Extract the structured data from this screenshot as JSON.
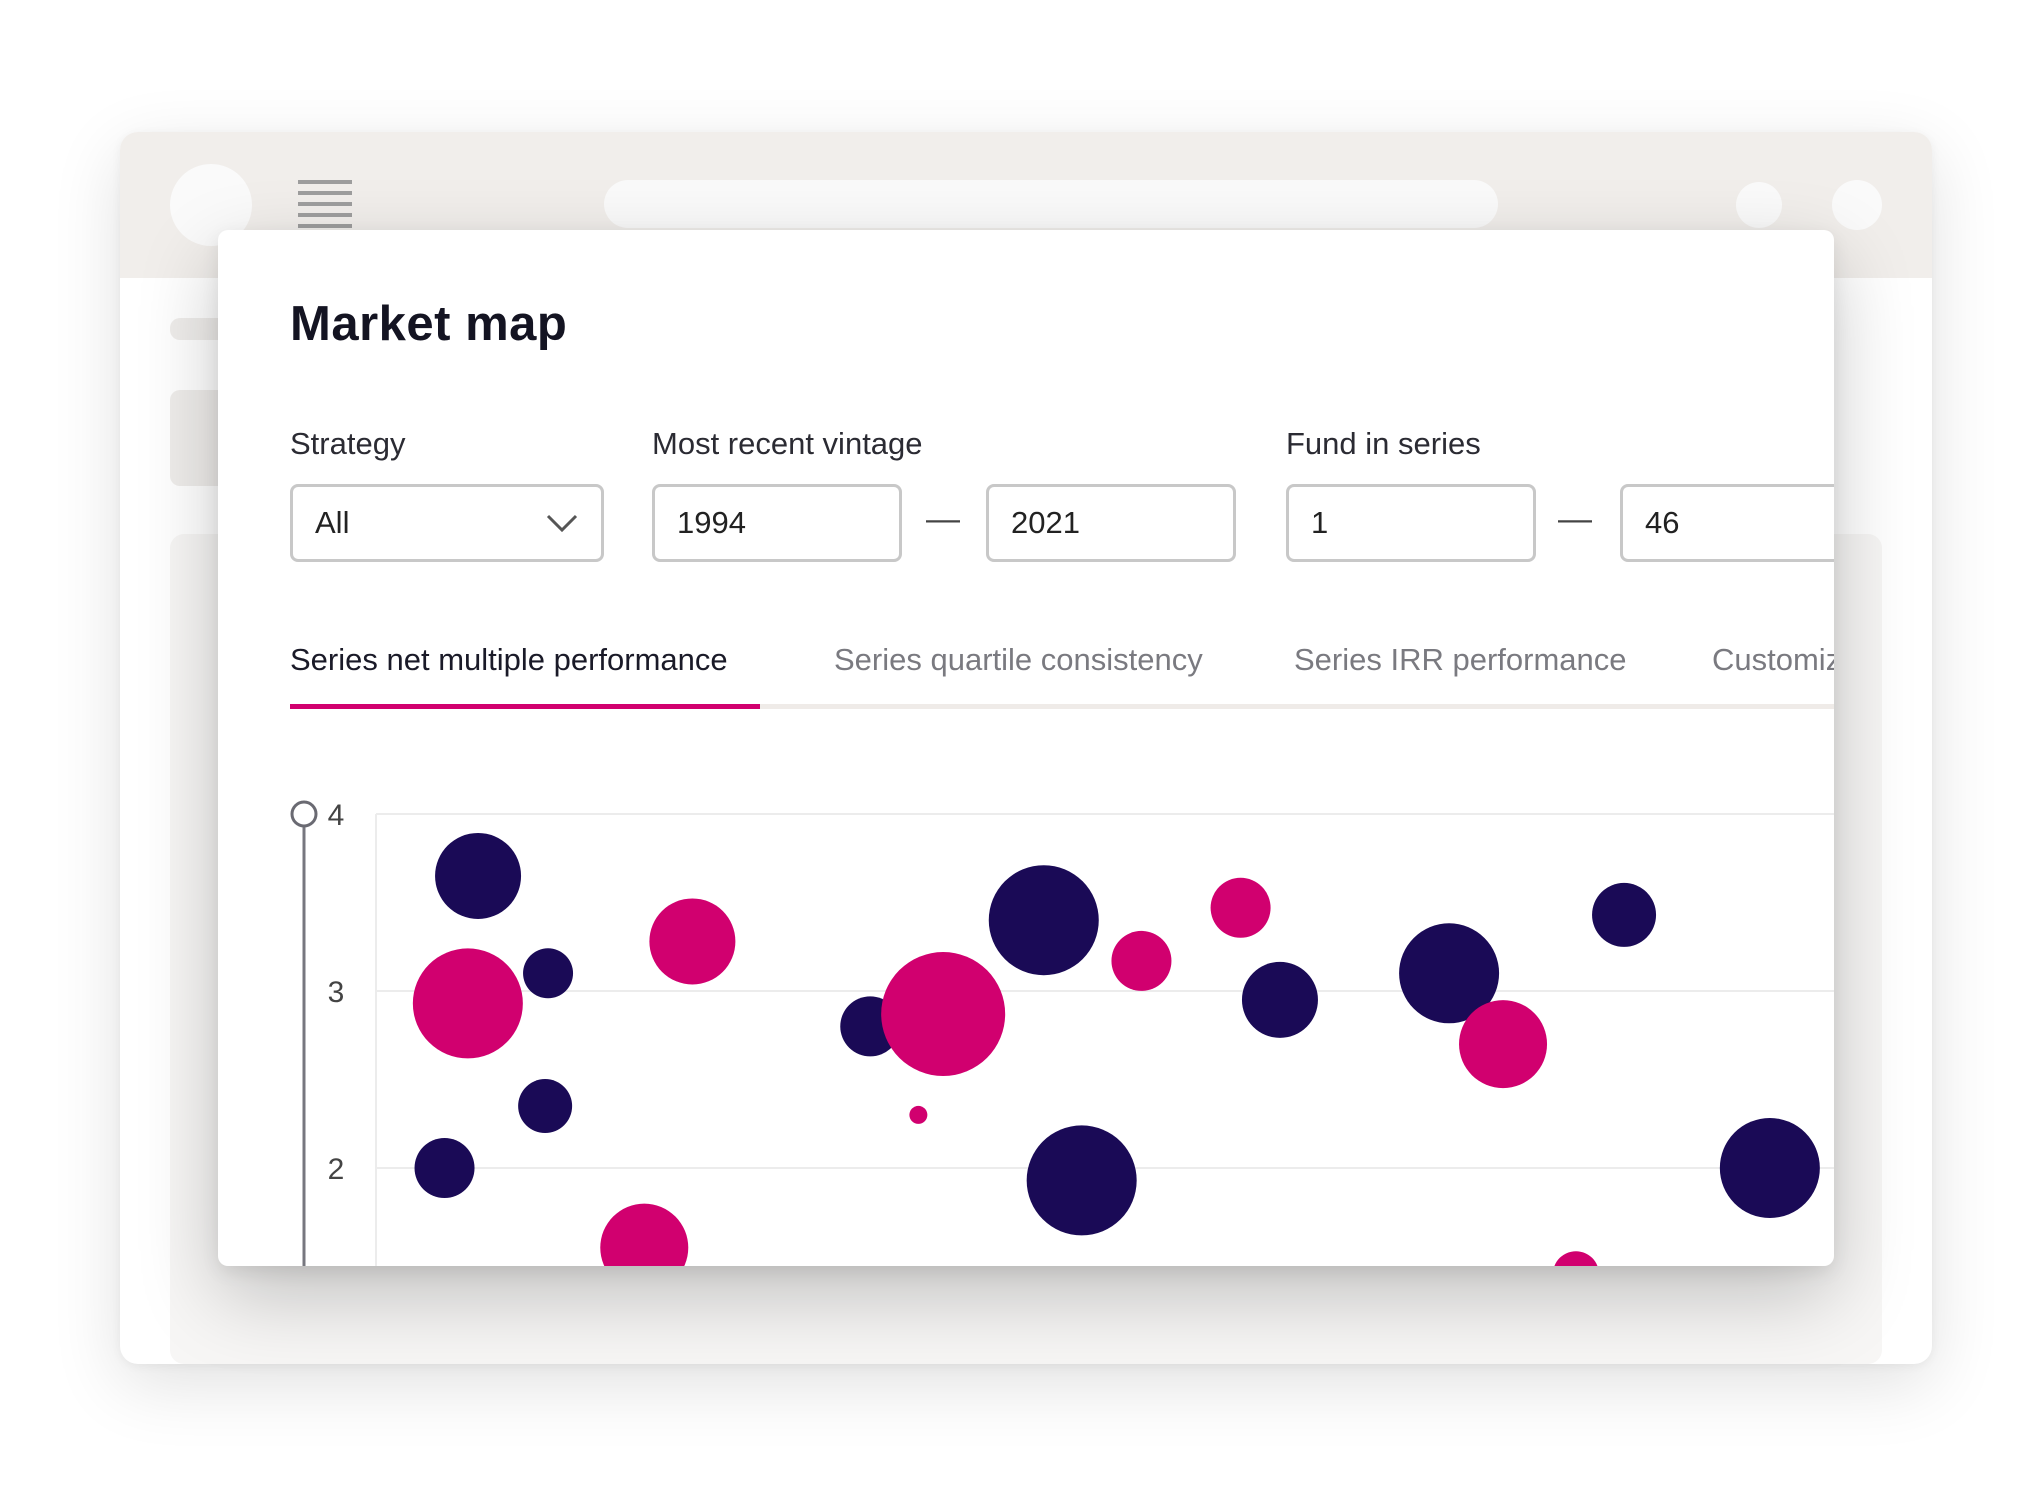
{
  "colors": {
    "navy": "#1a0a56",
    "magenta": "#d1006f",
    "accent": "#d1006f"
  },
  "icons": {
    "menu": "hamburger-icon",
    "dropdown": "chevron-down-icon",
    "slider": "slider-handle"
  },
  "page": {
    "title": "Market map"
  },
  "filters": {
    "strategy": {
      "label": "Strategy",
      "value": "All"
    },
    "vintage": {
      "label": "Most recent vintage",
      "from": "1994",
      "to": "2021"
    },
    "fund_series": {
      "label": "Fund in series",
      "from": "1",
      "to": "46"
    },
    "separator": "—"
  },
  "tabs": [
    {
      "label": "Series net multiple performance",
      "active": true
    },
    {
      "label": "Series quartile consistency",
      "active": false
    },
    {
      "label": "Series IRR performance",
      "active": false
    },
    {
      "label": "Customiz",
      "active": false
    }
  ],
  "chart_data": {
    "type": "scatter",
    "y_ticks": [
      4,
      3,
      2
    ],
    "ylim": [
      1.25,
      4
    ],
    "xlim": [
      0,
      100
    ],
    "grid": true,
    "series": [
      {
        "color": "#1a0a56",
        "points": [
          {
            "x": 7.0,
            "y": 3.65,
            "size": 43
          },
          {
            "x": 11.8,
            "y": 3.1,
            "size": 25
          },
          {
            "x": 11.6,
            "y": 2.35,
            "size": 27
          },
          {
            "x": 4.7,
            "y": 2.0,
            "size": 30
          },
          {
            "x": 33.9,
            "y": 2.8,
            "size": 30
          },
          {
            "x": 45.8,
            "y": 3.4,
            "size": 55
          },
          {
            "x": 48.4,
            "y": 1.93,
            "size": 55
          },
          {
            "x": 62.0,
            "y": 2.95,
            "size": 38
          },
          {
            "x": 73.6,
            "y": 3.1,
            "size": 50
          },
          {
            "x": 85.6,
            "y": 3.43,
            "size": 32
          },
          {
            "x": 95.6,
            "y": 2.0,
            "size": 50
          }
        ]
      },
      {
        "color": "#d1006f",
        "points": [
          {
            "x": 6.3,
            "y": 2.93,
            "size": 55
          },
          {
            "x": 21.7,
            "y": 3.28,
            "size": 43
          },
          {
            "x": 18.4,
            "y": 1.55,
            "size": 44
          },
          {
            "x": 38.9,
            "y": 2.87,
            "size": 62
          },
          {
            "x": 37.2,
            "y": 2.3,
            "size": 9
          },
          {
            "x": 52.5,
            "y": 3.17,
            "size": 30
          },
          {
            "x": 59.3,
            "y": 3.47,
            "size": 30
          },
          {
            "x": 77.3,
            "y": 2.7,
            "size": 44
          },
          {
            "x": 82.3,
            "y": 1.4,
            "size": 23
          }
        ]
      }
    ]
  }
}
